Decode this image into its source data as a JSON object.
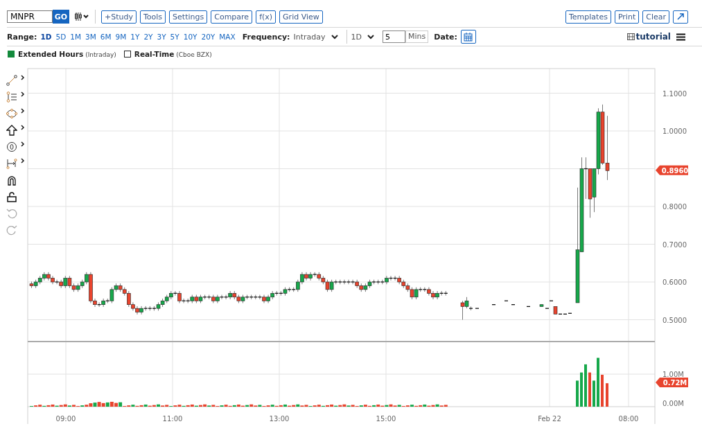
{
  "toolbar": {
    "symbol": "MNPR",
    "go": "GO",
    "buttons": [
      "+Study",
      "Tools",
      "Settings",
      "Compare",
      "f(x)",
      "Grid View"
    ],
    "right_buttons": [
      "Templates",
      "Print",
      "Clear"
    ]
  },
  "range_bar": {
    "label": "Range:",
    "options": [
      {
        "label": "1D",
        "selected": true
      },
      {
        "label": "5D",
        "selected": false
      },
      {
        "label": "1M",
        "selected": false
      },
      {
        "label": "3M",
        "selected": false
      },
      {
        "label": "6M",
        "selected": false
      },
      {
        "label": "9M",
        "selected": false
      },
      {
        "label": "1Y",
        "selected": false
      },
      {
        "label": "2Y",
        "selected": false
      },
      {
        "label": "3Y",
        "selected": false
      },
      {
        "label": "5Y",
        "selected": false
      },
      {
        "label": "10Y",
        "selected": false
      },
      {
        "label": "20Y",
        "selected": false
      },
      {
        "label": "MAX",
        "selected": false
      }
    ],
    "frequency_label": "Frequency:",
    "frequency": "Intraday",
    "period": "1D",
    "interval": "5",
    "interval_unit": "Mins",
    "date_label": "Date:",
    "tutorial": "tutorial"
  },
  "legend": [
    {
      "label": "Extended Hours",
      "note": "(Intraday)",
      "checked": true
    },
    {
      "label": "Real-Time",
      "note": "(Cboe BZX)",
      "checked": false
    }
  ],
  "drawing_tools": [
    {
      "kind": "line",
      "has_menu": true,
      "disabled": false
    },
    {
      "kind": "fib",
      "has_menu": true,
      "disabled": false
    },
    {
      "kind": "shape",
      "has_menu": true,
      "disabled": false
    },
    {
      "kind": "arrow",
      "has_menu": true,
      "disabled": false
    },
    {
      "kind": "text",
      "has_menu": true,
      "disabled": false
    },
    {
      "kind": "measure",
      "has_menu": true,
      "disabled": false
    },
    {
      "kind": "magnet",
      "has_menu": false,
      "disabled": false
    },
    {
      "kind": "lock",
      "has_menu": false,
      "disabled": false
    },
    {
      "kind": "undo",
      "has_menu": false,
      "disabled": true
    },
    {
      "kind": "redo",
      "has_menu": false,
      "disabled": true
    }
  ],
  "chart": {
    "price_ticks": [
      "1.1000",
      "1.0000",
      "0.8000",
      "0.7000",
      "0.6000",
      "0.5000"
    ],
    "last_price": "0.8960",
    "volume_ticks": [
      "1.00M",
      "0.00M"
    ],
    "last_volume": "0.72M",
    "time_ticks": [
      "09:00",
      "11:00",
      "13:00",
      "15:00",
      "Feb 22",
      "08:00"
    ]
  }
}
